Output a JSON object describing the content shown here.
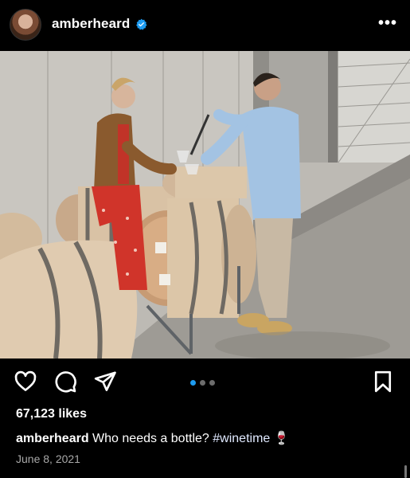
{
  "header": {
    "username": "amberheard",
    "avatar_icon": "profile-photo",
    "verified_icon": "verified-badge-icon",
    "more_label": "•••"
  },
  "post": {
    "image_description_icon": "wine-barrel-photo",
    "carousel": {
      "total": 3,
      "current": 1,
      "active_color": "#1d9bf0"
    }
  },
  "actions": {
    "like_icon": "heart-icon",
    "comment_icon": "comment-icon",
    "share_icon": "send-icon",
    "save_icon": "bookmark-icon"
  },
  "likes": "67,123 likes",
  "caption": {
    "username": "amberheard",
    "text": "Who needs a bottle?",
    "hashtag": "#winetime",
    "emoji": "🍷"
  },
  "date": "June 8, 2021"
}
